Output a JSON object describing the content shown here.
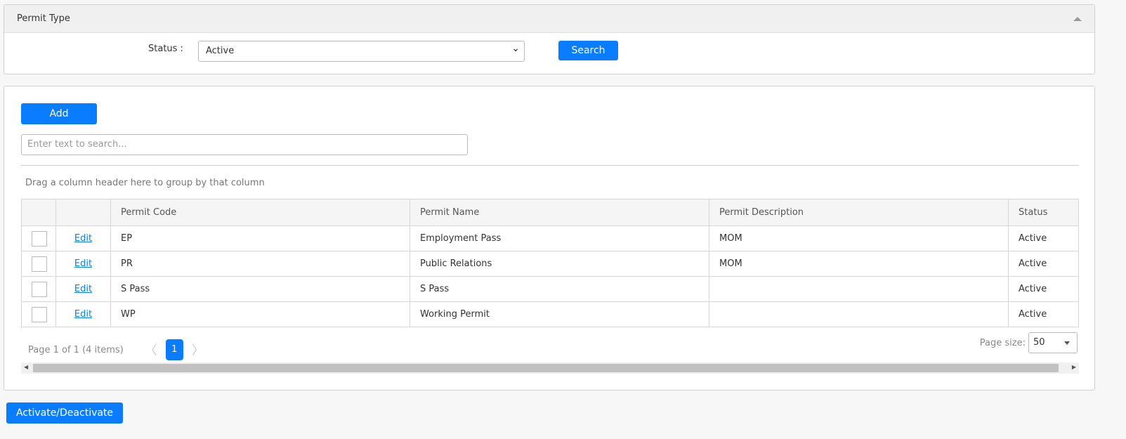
{
  "filter": {
    "title": "Permit Type",
    "status_label": "Status :",
    "status_value": "Active",
    "search_label": "Search"
  },
  "grid": {
    "add_label": "Add",
    "search_placeholder": "Enter text to search...",
    "group_hint": "Drag a column header here to group by that column",
    "columns": [
      "Permit Code",
      "Permit Name",
      "Permit Description",
      "Status"
    ],
    "rows": [
      {
        "edit": "Edit",
        "code": "EP",
        "name": "Employment Pass",
        "desc": "MOM",
        "status": "Active"
      },
      {
        "edit": "Edit",
        "code": "PR",
        "name": "Public Relations",
        "desc": "MOM",
        "status": "Active"
      },
      {
        "edit": "Edit",
        "code": "S Pass",
        "name": "S Pass",
        "desc": "",
        "status": "Active"
      },
      {
        "edit": "Edit",
        "code": "WP",
        "name": "Working Permit",
        "desc": "",
        "status": "Active"
      }
    ],
    "pager_info": "Page 1 of 1 (4 items)",
    "current_page": "1",
    "page_size_label": "Page size:",
    "page_size": "50"
  },
  "footer": {
    "activate_label": "Activate/Deactivate"
  },
  "colors": {
    "accent": "#0a7cff"
  }
}
